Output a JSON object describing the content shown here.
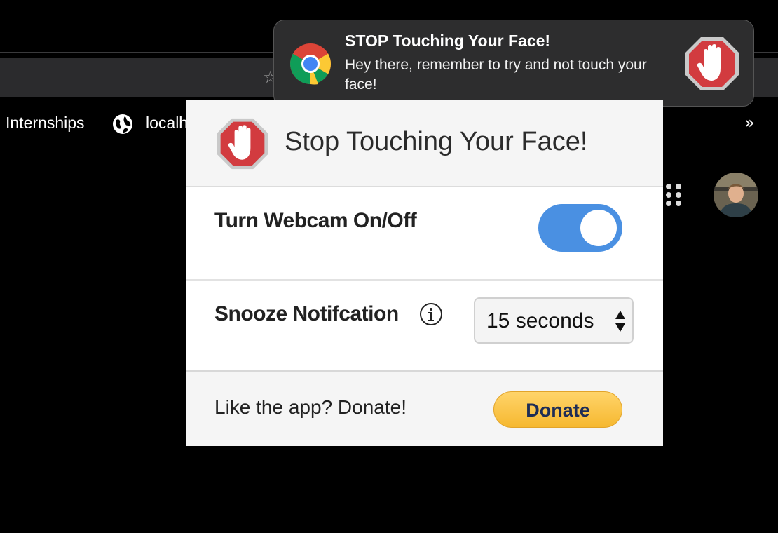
{
  "browser": {
    "bookmarks": [
      {
        "label": "Internships"
      },
      {
        "label": "localh"
      }
    ],
    "more_glyph": "»",
    "star_glyph": "☆"
  },
  "notification": {
    "title": "STOP Touching Your Face!",
    "body": "Hey there, remember to try and not touch your face!",
    "icons": [
      "chrome-icon",
      "stop-hand-icon"
    ]
  },
  "popup": {
    "title": "Stop Touching Your Face!",
    "webcam": {
      "label": "Turn Webcam On/Off",
      "enabled": true
    },
    "snooze": {
      "label": "Snooze Notifcation",
      "selected": "15 seconds"
    },
    "footer": {
      "text": "Like the app? Donate!",
      "donate_label": "Donate"
    }
  },
  "colors": {
    "toggle_on": "#4a90e2",
    "stop_red": "#d23b3f",
    "donate_gold": "#f6b830",
    "donate_text": "#1e2d56"
  }
}
